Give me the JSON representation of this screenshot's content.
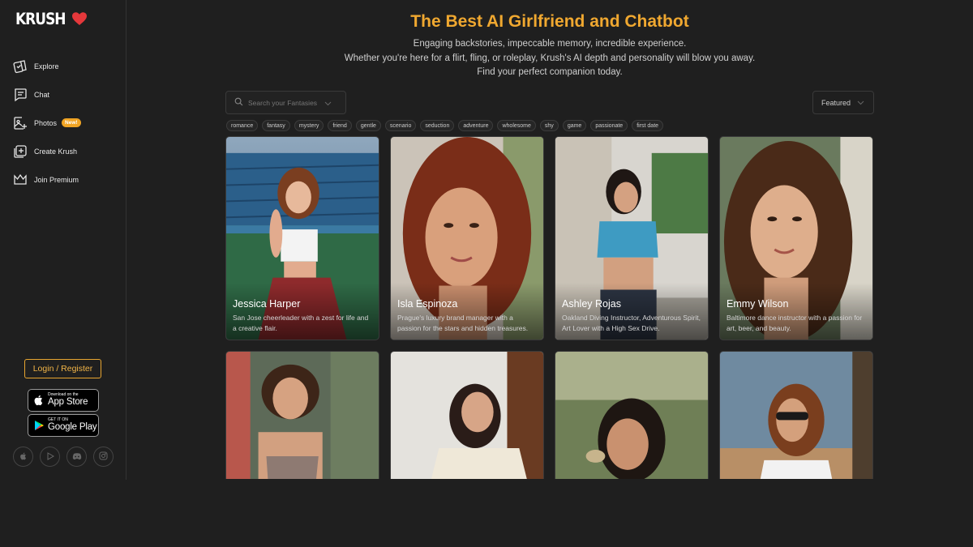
{
  "brand": {
    "logo_text": "KRUSH"
  },
  "sidebar": {
    "items": [
      {
        "label": "Explore",
        "icon": "cards-icon"
      },
      {
        "label": "Chat",
        "icon": "chat-icon"
      },
      {
        "label": "Photos",
        "icon": "photo-plus-icon",
        "badge": "New!"
      },
      {
        "label": "Create Krush",
        "icon": "plus-square-icon"
      },
      {
        "label": "Join Premium",
        "icon": "crown-icon"
      }
    ],
    "login_label": "Login / Register",
    "app_store": {
      "small": "Download on the",
      "big": "App Store"
    },
    "google_play": {
      "small": "GET IT ON",
      "big": "Google Play"
    },
    "socials": [
      "apple-icon",
      "play-icon",
      "discord-icon",
      "instagram-icon"
    ]
  },
  "header": {
    "title": "The Best AI Girlfriend and Chatbot",
    "subtitle_lines": [
      "Engaging backstories, impeccable memory, incredible experience.",
      "Whether you're here for a flirt, fling, or roleplay, Krush's AI depth and personality will blow you away.",
      "Find your perfect companion today."
    ]
  },
  "search": {
    "placeholder": "Search your Fantasies"
  },
  "sort": {
    "selected": "Featured"
  },
  "tags": [
    "romance",
    "fantasy",
    "mystery",
    "friend",
    "gentle",
    "scenario",
    "seduction",
    "adventure",
    "wholesome",
    "shy",
    "game",
    "passionate",
    "first date"
  ],
  "cards": [
    {
      "name": "Jessica Harper",
      "desc": "San Jose cheerleader with a zest for life and a creative flair."
    },
    {
      "name": "Isla Espinoza",
      "desc": "Prague's luxury brand manager with a passion for the stars and hidden treasures."
    },
    {
      "name": "Ashley Rojas",
      "desc": "Oakland Diving Instructor, Adventurous Spirit, Art Lover with a High Sex Drive."
    },
    {
      "name": "Emmy Wilson",
      "desc": "Baltimore dance instructor with a passion for art, beer, and beauty."
    },
    {
      "name": "",
      "desc": ""
    },
    {
      "name": "",
      "desc": ""
    },
    {
      "name": "",
      "desc": ""
    },
    {
      "name": "",
      "desc": ""
    }
  ],
  "colors": {
    "accent": "#f0a830",
    "background": "#1f1f1f",
    "heart": "#e5383b"
  }
}
